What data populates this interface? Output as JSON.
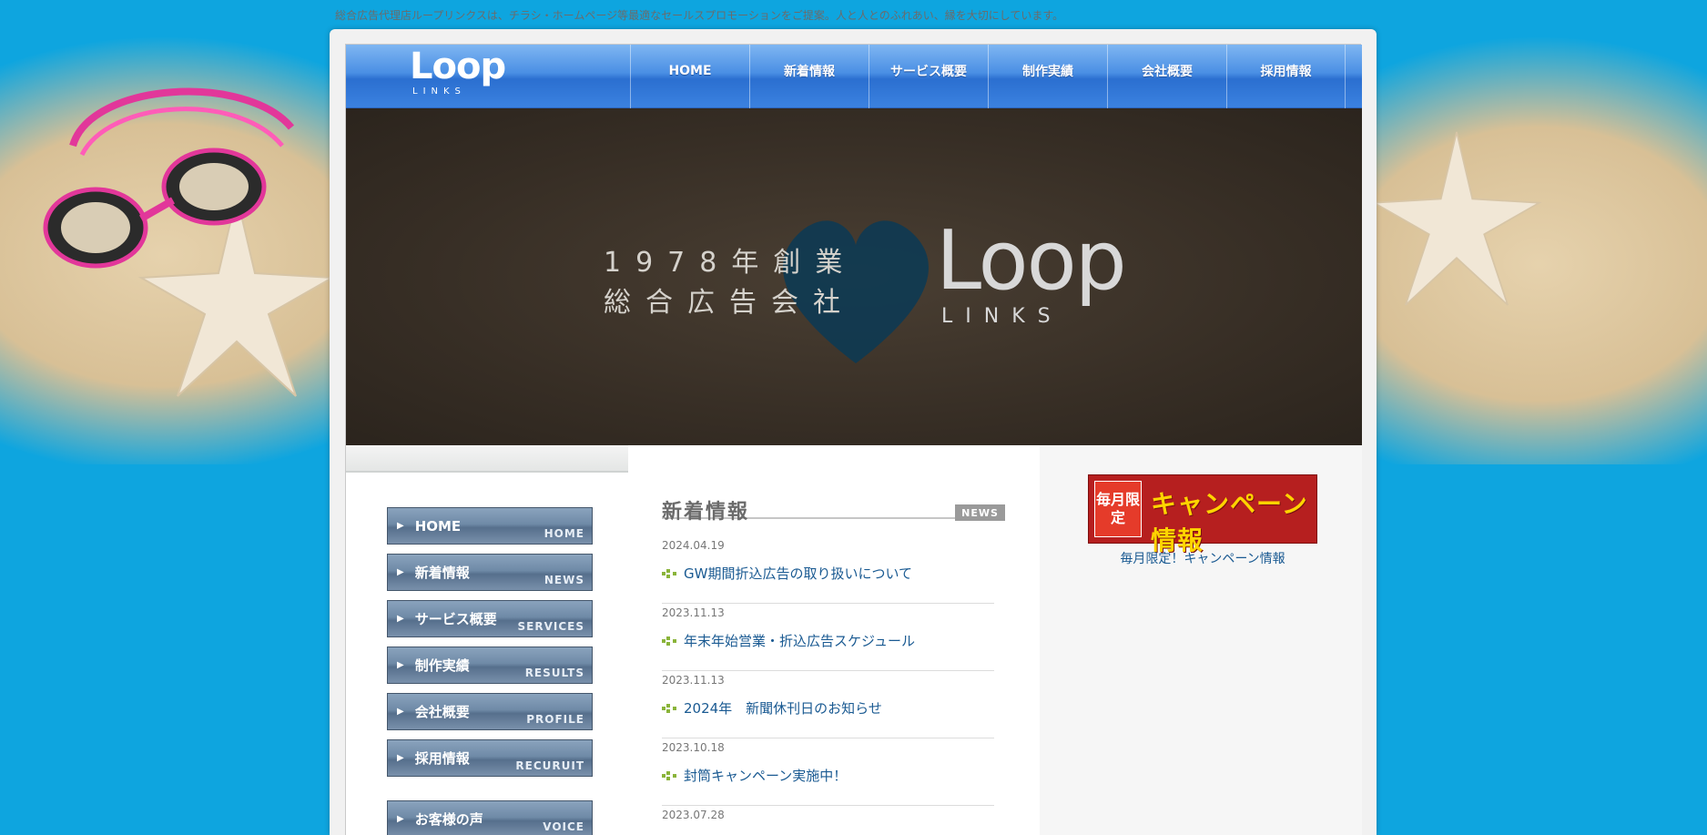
{
  "tagline": "総合広告代理店ループリンクスは、チラシ・ホームページ等最適なセールスプロモーションをご提案。人と人とのふれあい、縁を大切にしています。",
  "logo": {
    "main": "Loop",
    "sub": "LINKS"
  },
  "nav": {
    "items": [
      {
        "label": "HOME"
      },
      {
        "label": "新着情報"
      },
      {
        "label": "サービス概要"
      },
      {
        "label": "制作実績"
      },
      {
        "label": "会社概要"
      },
      {
        "label": "採用情報"
      }
    ]
  },
  "hero": {
    "line1": "1978年創業",
    "line2": "総合広告会社",
    "logo_main": "Loop",
    "logo_sub": "LINKS"
  },
  "sidebar": {
    "items": [
      {
        "label": "HOME",
        "en": "HOME"
      },
      {
        "label": "新着情報",
        "en": "NEWS"
      },
      {
        "label": "サービス概要",
        "en": "SERVICES"
      },
      {
        "label": "制作実績",
        "en": "RESULTS"
      },
      {
        "label": "会社概要",
        "en": "PROFILE"
      },
      {
        "label": "採用情報",
        "en": "RECURUIT"
      },
      {
        "label": "お客様の声",
        "en": "VOICE"
      }
    ]
  },
  "news": {
    "title": "新着情報",
    "badge": "NEWS",
    "items": [
      {
        "date": "2024.04.19",
        "title": "GW期間折込広告の取り扱いについて"
      },
      {
        "date": "2023.11.13",
        "title": "年末年始営業・折込広告スケジュール"
      },
      {
        "date": "2023.11.13",
        "title": "2024年　新聞休刊日のお知らせ"
      },
      {
        "date": "2023.10.18",
        "title": "封筒キャンペーン実施中！"
      },
      {
        "date": "2023.07.28",
        "title": ""
      }
    ]
  },
  "campaign": {
    "badge": "毎月限定",
    "title": "キャンペーン情報",
    "caption": "毎月限定！キャンペーン情報"
  },
  "colors": {
    "background": "#0ea5df",
    "nav_blue": "#3b82e0",
    "link": "#1a5a92",
    "campaign_red": "#b61f1f",
    "campaign_yellow": "#ffd400"
  }
}
